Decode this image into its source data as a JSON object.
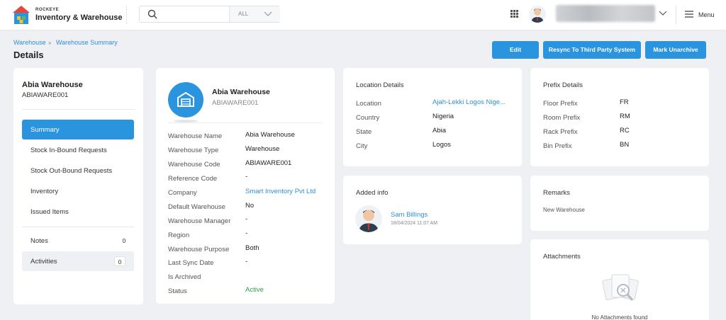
{
  "brand": {
    "small": "ROCKEYE",
    "main": "Inventory & Warehouse"
  },
  "search": {
    "value": "",
    "placeholder": "",
    "filter": "ALL"
  },
  "header": {
    "menu_label": "Menu"
  },
  "breadcrumb": {
    "items": [
      "Warehouse",
      "Warehouse Summary"
    ],
    "separator": "»"
  },
  "page_title": "Details",
  "actions": {
    "edit": "Edit",
    "resync": "Resync To Third Party System",
    "unarchive": "Mark Unarchive"
  },
  "sidebar": {
    "name": "Abia Warehouse",
    "code": "ABIAWARE001",
    "items": [
      {
        "label": "Summary"
      },
      {
        "label": "Stock In-Bound Requests"
      },
      {
        "label": "Stock Out-Bound Requests"
      },
      {
        "label": "Inventory"
      },
      {
        "label": "Issued Items"
      }
    ],
    "notes": {
      "label": "Notes",
      "count": "0"
    },
    "activities": {
      "label": "Activities",
      "count": "0"
    }
  },
  "warehouse": {
    "name": "Abia Warehouse",
    "code": "ABIAWARE001",
    "fields": [
      {
        "label": "Warehouse Name",
        "value": "Abia Warehouse"
      },
      {
        "label": "Warehouse Type",
        "value": "Warehouse"
      },
      {
        "label": "Warehouse Code",
        "value": "ABIAWARE001"
      },
      {
        "label": "Reference Code",
        "value": "-"
      },
      {
        "label": "Company",
        "value": "Smart Inventory Pvt Ltd"
      },
      {
        "label": "Default Warehouse",
        "value": "No"
      },
      {
        "label": "Warehouse Manager",
        "value": "-"
      },
      {
        "label": "Region",
        "value": "-"
      },
      {
        "label": "Warehouse Purpose",
        "value": "Both"
      },
      {
        "label": "Last Sync Date",
        "value": "-"
      },
      {
        "label": "Is Archived",
        "value": ""
      },
      {
        "label": "Status",
        "value": "Active"
      }
    ]
  },
  "location": {
    "title": "Location Details",
    "fields": [
      {
        "label": "Location",
        "value": "Ajah-Lekki Logos Nige..."
      },
      {
        "label": "Country",
        "value": "Nigeria"
      },
      {
        "label": "State",
        "value": "Abia"
      },
      {
        "label": "City",
        "value": "Logos"
      }
    ]
  },
  "prefix": {
    "title": "Prefix Details",
    "fields": [
      {
        "label": "Floor Prefix",
        "value": "FR"
      },
      {
        "label": "Room Prefix",
        "value": "RM"
      },
      {
        "label": "Rack Prefix",
        "value": "RC"
      },
      {
        "label": "Bin Prefix",
        "value": "BN"
      }
    ]
  },
  "added_info": {
    "title": "Added info",
    "user": "Sam Billings",
    "timestamp": "18/04/2024 11:07 AM"
  },
  "remarks": {
    "title": "Remarks",
    "text": "New Warehouse"
  },
  "attachments": {
    "title": "Attachments",
    "empty": "No Attachments found"
  },
  "colors": {
    "accent": "#2b94de",
    "link": "#2f8fd8",
    "active_status": "#2aa04a"
  }
}
